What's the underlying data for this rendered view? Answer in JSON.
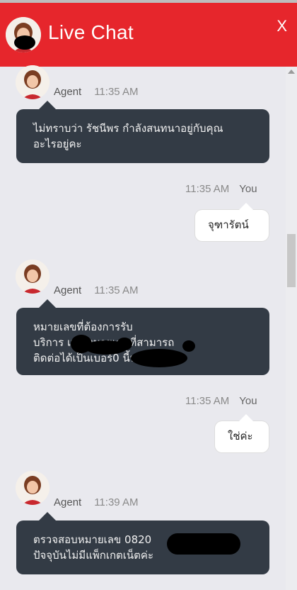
{
  "header": {
    "title": "Live Chat",
    "close_label": "X",
    "background": "#e6262c"
  },
  "messages": [
    {
      "sender": "Agent",
      "time": "11:35 AM",
      "lines": [
        "ไม่ทราบว่า รัชนีพร กำลังสนทนาอยู่กับคุณ",
        "อะไรอยู่คะ"
      ]
    },
    {
      "sender": "You",
      "time": "11:35 AM",
      "text": "จุฑารัตน์"
    },
    {
      "sender": "Agent",
      "time": "11:35 AM",
      "lines": [
        "หมายเลขที่ต้องการรับ",
        "บริการ              และหมายเลขที่สามารถ",
        "ติดต่อได้เป็นเบอร์0                นี้นะคะ"
      ]
    },
    {
      "sender": "You",
      "time": "11:35 AM",
      "text": "ใช่ค่ะ"
    },
    {
      "sender": "Agent",
      "time": "11:39 AM",
      "lines": [
        "ตรวจสอบหมายเลข 0820",
        "ปัจจุบันไม่มีแพ็กเกตเน็ตค่ะ"
      ]
    }
  ],
  "colors": {
    "agent_bubble": "#333b45",
    "user_bubble": "#ffffff",
    "chat_background": "#e9e9ee"
  }
}
